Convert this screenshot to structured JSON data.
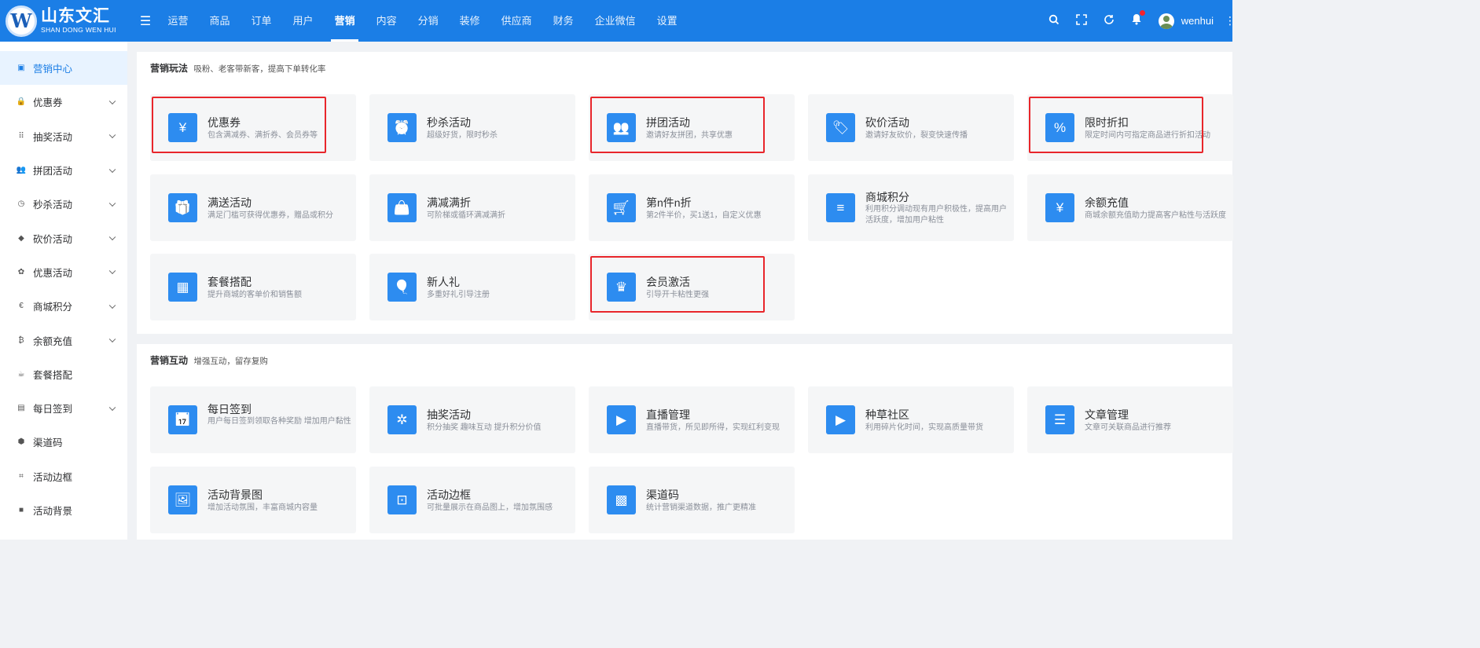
{
  "brand": {
    "cn": "山东文汇",
    "en": "SHAN DONG WEN HUI",
    "mark": "W"
  },
  "topnav": [
    "运营",
    "商品",
    "订单",
    "用户",
    "营销",
    "内容",
    "分销",
    "装修",
    "供应商",
    "财务",
    "企业微信",
    "设置"
  ],
  "topnav_active": "营销",
  "user": {
    "name": "wenhui"
  },
  "icons": {
    "menu_toggle": "menu-fold-icon",
    "search": "search-icon",
    "fullscreen": "fullscreen-icon",
    "refresh": "refresh-icon",
    "bell": "bell-icon",
    "more": "more-vertical-icon"
  },
  "sidebar": [
    {
      "label": "营销中心",
      "icon": "marketing-icon",
      "active": true,
      "arrow": false
    },
    {
      "label": "优惠券",
      "icon": "lock-icon",
      "arrow": true
    },
    {
      "label": "抽奖活动",
      "icon": "grid-icon",
      "arrow": true
    },
    {
      "label": "拼团活动",
      "icon": "users-icon",
      "arrow": true
    },
    {
      "label": "秒杀活动",
      "icon": "clock-icon",
      "arrow": true
    },
    {
      "label": "砍价活动",
      "icon": "tag-icon",
      "arrow": true
    },
    {
      "label": "优惠活动",
      "icon": "gift-icon",
      "arrow": true
    },
    {
      "label": "商城积分",
      "icon": "euro-icon",
      "arrow": true
    },
    {
      "label": "余额充值",
      "icon": "bitcoin-icon",
      "arrow": true
    },
    {
      "label": "套餐搭配",
      "icon": "cup-icon",
      "arrow": false
    },
    {
      "label": "每日签到",
      "icon": "calendar-icon",
      "arrow": true
    },
    {
      "label": "渠道码",
      "icon": "box-icon",
      "arrow": false
    },
    {
      "label": "活动边框",
      "icon": "crop-icon",
      "arrow": false
    },
    {
      "label": "活动背景",
      "icon": "square-icon",
      "arrow": false
    }
  ],
  "section1": {
    "title": "营销玩法",
    "subtitle": "吸粉、老客带新客，提高下单转化率",
    "cards": [
      {
        "title": "优惠券",
        "desc": "包含满减券、满折券、会员券等",
        "icon": "coupon-icon",
        "glyph": "¥",
        "highlight": true
      },
      {
        "title": "秒杀活动",
        "desc": "超级好货，限时秒杀",
        "icon": "alarm-clock-icon",
        "glyph": "⏰"
      },
      {
        "title": "拼团活动",
        "desc": "邀请好友拼团，共享优惠",
        "icon": "group-users-icon",
        "glyph": "👥",
        "highlight": true
      },
      {
        "title": "砍价活动",
        "desc": "邀请好友砍价，裂变快速传播",
        "icon": "price-tag-icon",
        "glyph": "🏷"
      },
      {
        "title": "限时折扣",
        "desc": "限定时间内可指定商品进行折扣活动",
        "icon": "discount-tag-icon",
        "glyph": "%",
        "highlight": true
      },
      {
        "title": "满送活动",
        "desc": "满足门槛可获得优惠券，赠品或积分",
        "icon": "gift-box-icon",
        "glyph": "🎁"
      },
      {
        "title": "满减满折",
        "desc": "可阶梯或循环满减满折",
        "icon": "shopping-bag-icon",
        "glyph": "👜"
      },
      {
        "title": "第n件n折",
        "desc": "第2件半价，买1送1，自定义优惠",
        "icon": "shopping-cart-icon",
        "glyph": "🛒"
      },
      {
        "title": "商城积分",
        "desc": "利用积分调动现有用户积极性，提高用户活跃度，增加用户粘性",
        "icon": "coin-stack-icon",
        "glyph": "≡"
      },
      {
        "title": "余额充值",
        "desc": "商城余额充值助力提高客户粘性与活跃度",
        "icon": "money-bag-icon",
        "glyph": "¥"
      },
      {
        "title": "套餐搭配",
        "desc": "提升商城的客单价和销售额",
        "icon": "apps-grid-icon",
        "glyph": "▦"
      },
      {
        "title": "新人礼",
        "desc": "多重好礼引导注册",
        "icon": "balloons-icon",
        "glyph": "🎈"
      },
      {
        "title": "会员激活",
        "desc": "引导开卡粘性更强",
        "icon": "crown-icon",
        "glyph": "♛",
        "highlight": true
      }
    ]
  },
  "section2": {
    "title": "营销互动",
    "subtitle": "增强互动，留存复购",
    "cards": [
      {
        "title": "每日签到",
        "desc": "用户每日签到领取各种奖励 增加用户黏性",
        "icon": "calendar-check-icon",
        "glyph": "📅"
      },
      {
        "title": "抽奖活动",
        "desc": "积分抽奖 趣味互动 提升积分价值",
        "icon": "wheel-icon",
        "glyph": "✲"
      },
      {
        "title": "直播管理",
        "desc": "直播带货，所见即所得，实现红利变现",
        "icon": "live-tv-icon",
        "glyph": "▶"
      },
      {
        "title": "种草社区",
        "desc": "利用碎片化时间，实现高质量带货",
        "icon": "video-clip-icon",
        "glyph": "▶"
      },
      {
        "title": "文章管理",
        "desc": "文章可关联商品进行推荐",
        "icon": "article-icon",
        "glyph": "☰"
      },
      {
        "title": "活动背景图",
        "desc": "增加活动氛围，丰富商城内容量",
        "icon": "image-icon",
        "glyph": "🖼"
      },
      {
        "title": "活动边框",
        "desc": "可批量展示在商品图上，增加氛围感",
        "icon": "frame-icon",
        "glyph": "⊡"
      },
      {
        "title": "渠道码",
        "desc": "统计营销渠道数据，推广更精准",
        "icon": "qrcode-icon",
        "glyph": "▩"
      }
    ]
  },
  "colors": {
    "primary": "#1b7ee6",
    "card_icon": "#2d8cf0",
    "highlight": "#e8262b",
    "sidebar_active_bg": "#e8f3ff"
  }
}
